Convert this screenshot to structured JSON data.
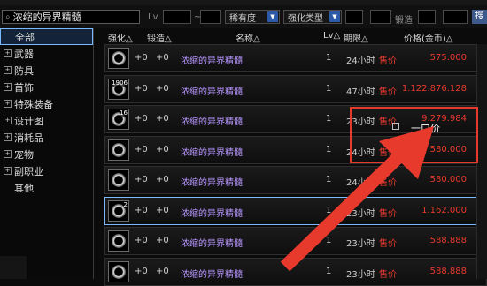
{
  "toolbar": {
    "search_value": "浓缩的异界精髓",
    "lv_label": "Lv",
    "dash": "~",
    "rarity_dropdown": "稀有度",
    "enhance_dropdown": "强化类型",
    "forge_label": "锻造",
    "search_button": "搜"
  },
  "sidebar": {
    "items": [
      {
        "label": "全部",
        "expandable": false,
        "selected": true
      },
      {
        "label": "武器",
        "expandable": true
      },
      {
        "label": "防具",
        "expandable": true
      },
      {
        "label": "首饰",
        "expandable": true
      },
      {
        "label": "特殊装备",
        "expandable": true
      },
      {
        "label": "设计图",
        "expandable": true
      },
      {
        "label": "消耗品",
        "expandable": true
      },
      {
        "label": "宠物",
        "expandable": true
      },
      {
        "label": "副职业",
        "expandable": true
      },
      {
        "label": "其他",
        "expandable": false
      }
    ]
  },
  "columns": {
    "enhance": "强化△",
    "refine": "锻造△",
    "name": "名称△",
    "lv": "Lv△",
    "time": "期限△",
    "price": "价格(金币)△"
  },
  "rows": [
    {
      "qty": "",
      "str": "+0",
      "ref": "+0",
      "name": "浓缩的异界精髓",
      "lv": "1",
      "time": "24小时",
      "price_label": "售价",
      "price": "575.000"
    },
    {
      "qty": "1906",
      "str": "+0",
      "ref": "+0",
      "name": "浓缩的异界精髓",
      "lv": "1",
      "time": "47小时",
      "price_label": "售价",
      "price": "1.122.876.128"
    },
    {
      "qty": "16",
      "str": "+0",
      "ref": "+0",
      "name": "浓缩的异界精髓",
      "lv": "1",
      "time": "23小时",
      "price_label": "售价",
      "price": "9.279.984"
    },
    {
      "qty": "",
      "str": "+0",
      "ref": "+0",
      "name": "浓缩的异界精髓",
      "lv": "1",
      "time": "24小时",
      "price_label": "售价",
      "price": "580.000"
    },
    {
      "qty": "",
      "str": "+0",
      "ref": "+0",
      "name": "浓缩的异界精髓",
      "lv": "1",
      "time": "24小时",
      "price_label": "售价",
      "price": "580.000"
    },
    {
      "qty": "2",
      "str": "+0",
      "ref": "+0",
      "name": "浓缩的异界精髓",
      "lv": "1",
      "time": "23小时",
      "price_label": "售价",
      "price": "1.162.000",
      "selected": true
    },
    {
      "qty": "",
      "str": "+0",
      "ref": "+0",
      "name": "浓缩的异界精髓",
      "lv": "1",
      "time": "23小时",
      "price_label": "售价",
      "price": "588.888"
    },
    {
      "qty": "",
      "str": "+0",
      "ref": "+0",
      "name": "浓缩的异界精髓",
      "lv": "1",
      "time": "23小时",
      "price_label": "售价",
      "price": "588.888"
    }
  ],
  "popup": {
    "buyout_label": "一口价"
  },
  "colors": {
    "price_red": "#e8392d",
    "name_purple": "#b896ff",
    "selection_blue": "#7bb9ff",
    "arrow_red": "#e8392d"
  }
}
